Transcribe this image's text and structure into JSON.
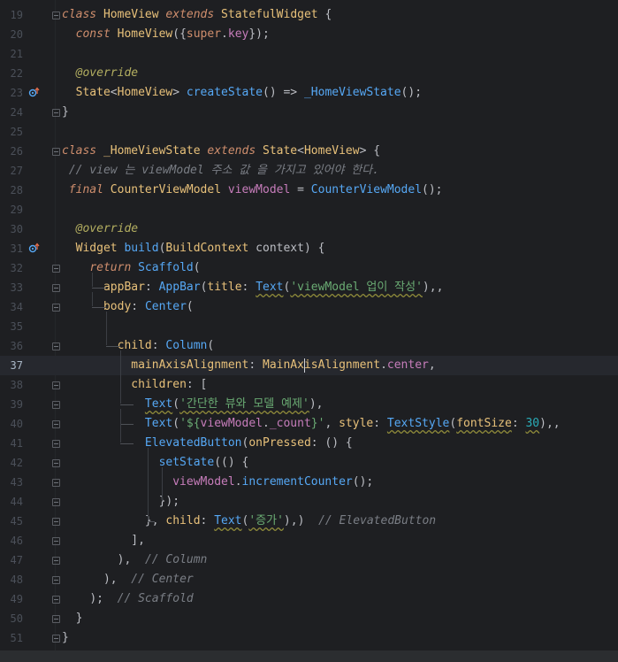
{
  "editor": {
    "current_line": 37,
    "lines": [
      {
        "n": "19",
        "tokens": [
          [
            "class",
            "kw"
          ],
          [
            " ",
            ""
          ],
          [
            "HomeView",
            "cls"
          ],
          [
            " ",
            ""
          ],
          [
            "extends",
            "kw"
          ],
          [
            " ",
            ""
          ],
          [
            "StatefulWidget",
            "cls"
          ],
          [
            " {",
            ""
          ]
        ]
      },
      {
        "n": "20",
        "tokens": [
          [
            "  ",
            ""
          ],
          [
            "const",
            "kw"
          ],
          [
            " ",
            ""
          ],
          [
            "HomeView",
            "cls"
          ],
          [
            "({",
            ""
          ],
          [
            "super",
            "kwn"
          ],
          [
            ".",
            ""
          ],
          [
            "key",
            "var"
          ],
          [
            "});",
            ""
          ]
        ]
      },
      {
        "n": "21",
        "tokens": []
      },
      {
        "n": "22",
        "tokens": [
          [
            "  ",
            ""
          ],
          [
            "@override",
            "ann"
          ]
        ]
      },
      {
        "n": "23",
        "tokens": [
          [
            "  ",
            ""
          ],
          [
            "State",
            "cls"
          ],
          [
            "<",
            ""
          ],
          [
            "HomeView",
            "cls"
          ],
          [
            "> ",
            ""
          ],
          [
            "createState",
            "fn"
          ],
          [
            "() => ",
            ""
          ],
          [
            "_HomeViewState",
            "fn"
          ],
          [
            "();",
            ""
          ]
        ]
      },
      {
        "n": "24",
        "tokens": [
          [
            "}",
            ""
          ]
        ]
      },
      {
        "n": "25",
        "tokens": []
      },
      {
        "n": "26",
        "tokens": [
          [
            "class",
            "kw"
          ],
          [
            " ",
            ""
          ],
          [
            "_HomeViewState",
            "cls"
          ],
          [
            " ",
            ""
          ],
          [
            "extends",
            "kw"
          ],
          [
            " ",
            ""
          ],
          [
            "State",
            "cls"
          ],
          [
            "<",
            ""
          ],
          [
            "HomeView",
            "cls"
          ],
          [
            "> {",
            ""
          ]
        ]
      },
      {
        "n": "27",
        "tokens": [
          [
            " ",
            ""
          ],
          [
            "// view 는 viewModel 주소 값 을 가지고 있어야 한다.",
            "cmt"
          ]
        ]
      },
      {
        "n": "28",
        "tokens": [
          [
            " ",
            ""
          ],
          [
            "final",
            "kw"
          ],
          [
            " ",
            ""
          ],
          [
            "CounterViewModel",
            "cls"
          ],
          [
            " ",
            ""
          ],
          [
            "viewModel",
            "var"
          ],
          [
            " = ",
            ""
          ],
          [
            "CounterViewModel",
            "fn"
          ],
          [
            "();",
            ""
          ]
        ]
      },
      {
        "n": "29",
        "tokens": []
      },
      {
        "n": "30",
        "tokens": [
          [
            "  ",
            ""
          ],
          [
            "@override",
            "ann"
          ]
        ]
      },
      {
        "n": "31",
        "tokens": [
          [
            "  ",
            ""
          ],
          [
            "Widget",
            "cls"
          ],
          [
            " ",
            ""
          ],
          [
            "build",
            "fn"
          ],
          [
            "(",
            ""
          ],
          [
            "BuildContext",
            "cls"
          ],
          [
            " context) {",
            ""
          ]
        ]
      },
      {
        "n": "32",
        "tokens": [
          [
            "    ",
            ""
          ],
          [
            "return",
            "kw"
          ],
          [
            " ",
            ""
          ],
          [
            "Scaffold",
            "fn"
          ],
          [
            "(",
            ""
          ]
        ]
      },
      {
        "n": "33",
        "tokens": [
          [
            "      ",
            ""
          ],
          [
            "appBar",
            "named"
          ],
          [
            ": ",
            ""
          ],
          [
            "AppBar",
            "fn"
          ],
          [
            "(",
            ""
          ],
          [
            "title",
            "named"
          ],
          [
            ": ",
            ""
          ],
          [
            "Text",
            "fn sq"
          ],
          [
            "(",
            ""
          ],
          [
            "'viewModel 업이 작성'",
            "str sq"
          ],
          [
            "),",
            ""
          ],
          [
            ",",
            ""
          ]
        ]
      },
      {
        "n": "34",
        "tokens": [
          [
            "      ",
            ""
          ],
          [
            "body",
            "named"
          ],
          [
            ": ",
            ""
          ],
          [
            "Center",
            "fn"
          ],
          [
            "(",
            ""
          ]
        ]
      },
      {
        "n": "35",
        "tokens": []
      },
      {
        "n": "36",
        "tokens": [
          [
            "        ",
            ""
          ],
          [
            "child",
            "named"
          ],
          [
            ": ",
            ""
          ],
          [
            "Column",
            "fn"
          ],
          [
            "(",
            ""
          ]
        ]
      },
      {
        "n": "37",
        "tokens": [
          [
            "          ",
            ""
          ],
          [
            "mainAxisAlignment",
            "named"
          ],
          [
            ": ",
            ""
          ],
          [
            "MainAxisAlignment",
            "cls"
          ],
          [
            ".",
            ""
          ],
          [
            "center",
            "var"
          ],
          [
            ",",
            ""
          ]
        ]
      },
      {
        "n": "38",
        "tokens": [
          [
            "          ",
            ""
          ],
          [
            "children",
            "named"
          ],
          [
            ": [",
            ""
          ]
        ]
      },
      {
        "n": "39",
        "tokens": [
          [
            "            ",
            ""
          ],
          [
            "Text",
            "fn sq"
          ],
          [
            "(",
            ""
          ],
          [
            "'간단한 뷰와 모델 예제'",
            "str sq"
          ],
          [
            "),",
            ""
          ]
        ]
      },
      {
        "n": "40",
        "tokens": [
          [
            "            ",
            ""
          ],
          [
            "Text",
            "fn"
          ],
          [
            "(",
            ""
          ],
          [
            "'${",
            "str"
          ],
          [
            "viewModel",
            "var"
          ],
          [
            ".",
            ""
          ],
          [
            "_count",
            "var"
          ],
          [
            "}'",
            "str"
          ],
          [
            ", ",
            ""
          ],
          [
            "style",
            "named"
          ],
          [
            ": ",
            ""
          ],
          [
            "TextStyle",
            "fn sq"
          ],
          [
            "(",
            ""
          ],
          [
            "fontSize",
            "named sq"
          ],
          [
            ": ",
            ""
          ],
          [
            "30",
            "num sq"
          ],
          [
            "),",
            ""
          ],
          [
            ",",
            ""
          ]
        ]
      },
      {
        "n": "41",
        "tokens": [
          [
            "            ",
            ""
          ],
          [
            "ElevatedButton",
            "fn"
          ],
          [
            "(",
            ""
          ],
          [
            "onPressed",
            "named"
          ],
          [
            ": () {",
            ""
          ]
        ]
      },
      {
        "n": "42",
        "tokens": [
          [
            "              ",
            ""
          ],
          [
            "setState",
            "fn"
          ],
          [
            "(() {",
            ""
          ]
        ]
      },
      {
        "n": "43",
        "tokens": [
          [
            "                ",
            ""
          ],
          [
            "viewModel",
            "var"
          ],
          [
            ".",
            ""
          ],
          [
            "incrementCounter",
            "fn"
          ],
          [
            "();",
            ""
          ]
        ]
      },
      {
        "n": "44",
        "tokens": [
          [
            "              ",
            ""
          ],
          [
            "});",
            ""
          ]
        ]
      },
      {
        "n": "45",
        "tokens": [
          [
            "            ",
            ""
          ],
          [
            "}, ",
            ""
          ],
          [
            "child",
            "named"
          ],
          [
            ": ",
            ""
          ],
          [
            "Text",
            "fn sq"
          ],
          [
            "(",
            ""
          ],
          [
            "'증가'",
            "str sq"
          ],
          [
            "),",
            ""
          ],
          [
            ")  ",
            ""
          ],
          [
            "// ElevatedButton",
            "cmt"
          ]
        ]
      },
      {
        "n": "46",
        "tokens": [
          [
            "          ",
            ""
          ],
          [
            "],",
            ""
          ]
        ]
      },
      {
        "n": "47",
        "tokens": [
          [
            "        ",
            ""
          ],
          [
            "),  ",
            ""
          ],
          [
            "// Column",
            "cmt"
          ]
        ]
      },
      {
        "n": "48",
        "tokens": [
          [
            "      ",
            ""
          ],
          [
            "),  ",
            ""
          ],
          [
            "// Center",
            "cmt"
          ]
        ]
      },
      {
        "n": "49",
        "tokens": [
          [
            "    ",
            ""
          ],
          [
            ");  ",
            ""
          ],
          [
            "// Scaffold",
            "cmt"
          ]
        ]
      },
      {
        "n": "50",
        "tokens": [
          [
            "  ",
            ""
          ],
          [
            "}",
            ""
          ]
        ]
      },
      {
        "n": "51",
        "tokens": [
          [
            "}",
            ""
          ]
        ]
      }
    ],
    "gutter_icons": {
      "23": "override-icon",
      "31": "override-icon"
    },
    "fold_markers": [
      "19",
      "24",
      "26",
      "32",
      "33",
      "34",
      "36",
      "38",
      "39",
      "40",
      "41",
      "42",
      "43",
      "44",
      "45",
      "46",
      "47",
      "48",
      "49",
      "50",
      "51"
    ]
  },
  "colors": {
    "background": "#1e1f22",
    "keyword": "#cf8e6d",
    "class": "#e8c17a",
    "function": "#56a8f5",
    "string": "#6aab73",
    "comment": "#7a7e85",
    "annotation": "#b3ae60",
    "field": "#c77dbb",
    "number": "#2aacb8"
  }
}
